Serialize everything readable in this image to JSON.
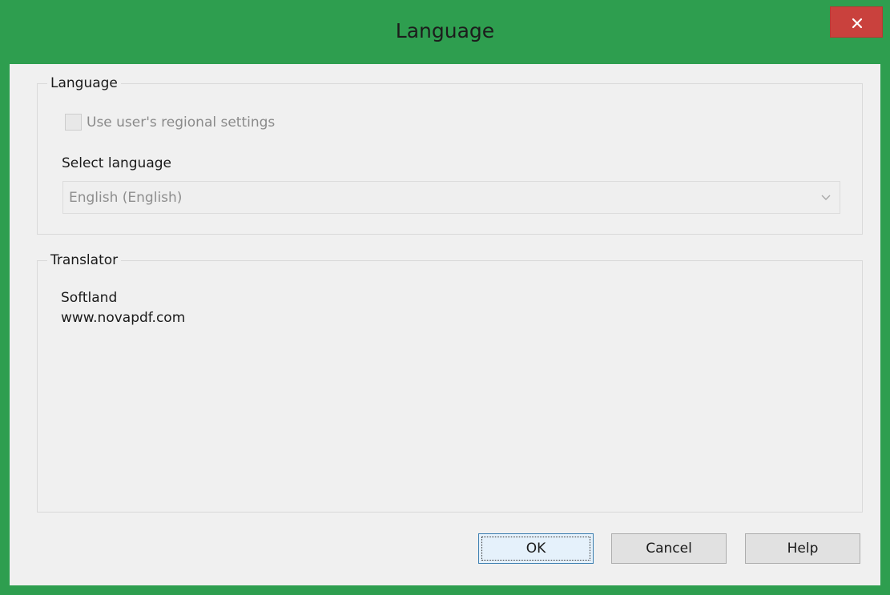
{
  "window": {
    "title": "Language"
  },
  "language_group": {
    "label": "Language",
    "use_regional_settings": {
      "label": "Use user's regional settings",
      "checked": false,
      "enabled": false
    },
    "select_language_label": "Select language",
    "select_language_value": "English (English)"
  },
  "translator_group": {
    "label": "Translator",
    "lines": [
      "Softland",
      "www.novapdf.com"
    ]
  },
  "buttons": {
    "ok": "OK",
    "cancel": "Cancel",
    "help": "Help"
  },
  "icons": {
    "close": "close-icon",
    "combo_arrow": "chevron-down-icon"
  },
  "colors": {
    "titlebar": "#2e9e4f",
    "close_button": "#c9413d",
    "client_background": "#f0f0f0"
  }
}
